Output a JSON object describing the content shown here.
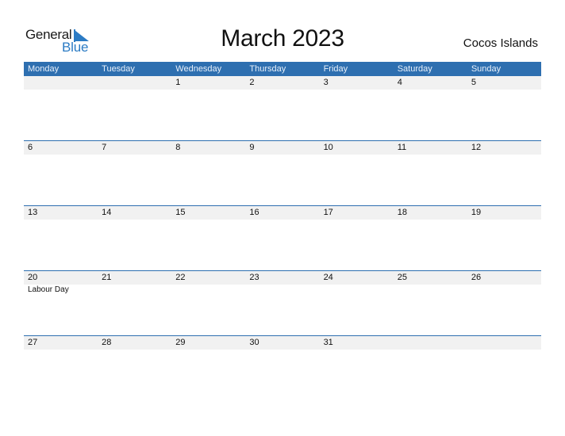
{
  "logo": {
    "line1": "General",
    "line2": "Blue"
  },
  "title": "March 2023",
  "region": "Cocos Islands",
  "weekdays": [
    "Monday",
    "Tuesday",
    "Wednesday",
    "Thursday",
    "Friday",
    "Saturday",
    "Sunday"
  ],
  "weeks": [
    {
      "days": [
        "",
        "",
        "1",
        "2",
        "3",
        "4",
        "5"
      ],
      "events": [
        "",
        "",
        "",
        "",
        "",
        "",
        ""
      ]
    },
    {
      "days": [
        "6",
        "7",
        "8",
        "9",
        "10",
        "11",
        "12"
      ],
      "events": [
        "",
        "",
        "",
        "",
        "",
        "",
        ""
      ]
    },
    {
      "days": [
        "13",
        "14",
        "15",
        "16",
        "17",
        "18",
        "19"
      ],
      "events": [
        "",
        "",
        "",
        "",
        "",
        "",
        ""
      ]
    },
    {
      "days": [
        "20",
        "21",
        "22",
        "23",
        "24",
        "25",
        "26"
      ],
      "events": [
        "Labour Day",
        "",
        "",
        "",
        "",
        "",
        ""
      ]
    },
    {
      "days": [
        "27",
        "28",
        "29",
        "30",
        "31",
        "",
        ""
      ],
      "events": [
        "",
        "",
        "",
        "",
        "",
        "",
        ""
      ]
    }
  ],
  "colors": {
    "header": "#2e6fb0",
    "brand": "#2b7bc4",
    "strip": "#f1f1f1"
  }
}
